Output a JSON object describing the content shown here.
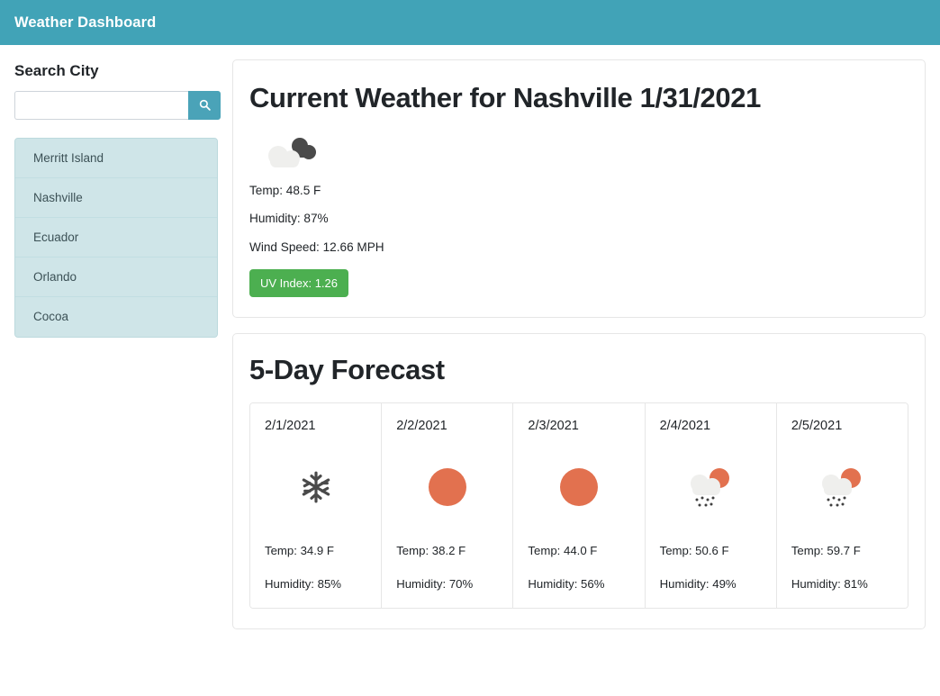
{
  "header": {
    "title": "Weather Dashboard",
    "bg_color": "#41a3b7"
  },
  "sidebar": {
    "search_label": "Search City",
    "search_value": "",
    "search_placeholder": "",
    "search_icon": "search-icon",
    "cities": [
      {
        "name": "Merritt Island"
      },
      {
        "name": "Nashville"
      },
      {
        "name": "Ecuador"
      },
      {
        "name": "Orlando"
      },
      {
        "name": "Cocoa"
      }
    ]
  },
  "current": {
    "title": "Current Weather for Nashville 1/31/2021",
    "icon": "broken-clouds-icon",
    "temp": "Temp: 48.5 F",
    "humidity": "Humidity: 87%",
    "wind": "Wind Speed: 12.66 MPH",
    "uv_index": "UV Index: 1.26",
    "uv_color": "#4caf50"
  },
  "forecast": {
    "title": "5-Day Forecast",
    "days": [
      {
        "date": "2/1/2021",
        "icon": "snowflake-icon",
        "temp": "Temp: 34.9 F",
        "humidity": "Humidity: 85%"
      },
      {
        "date": "2/2/2021",
        "icon": "sun-icon",
        "temp": "Temp: 38.2 F",
        "humidity": "Humidity: 70%"
      },
      {
        "date": "2/3/2021",
        "icon": "sun-icon",
        "temp": "Temp: 44.0 F",
        "humidity": "Humidity: 56%"
      },
      {
        "date": "2/4/2021",
        "icon": "sun-behind-rain-cloud-icon",
        "temp": "Temp: 50.6 F",
        "humidity": "Humidity: 49%"
      },
      {
        "date": "2/5/2021",
        "icon": "sun-behind-rain-cloud-icon",
        "temp": "Temp: 59.7 F",
        "humidity": "Humidity: 81%"
      }
    ]
  },
  "colors": {
    "accent_teal": "#4aa3b8",
    "city_item_bg": "#cfe5e8",
    "sun_orange": "#e2714f",
    "cloud_light": "#efefed",
    "cloud_dark": "#4a4a4a"
  }
}
